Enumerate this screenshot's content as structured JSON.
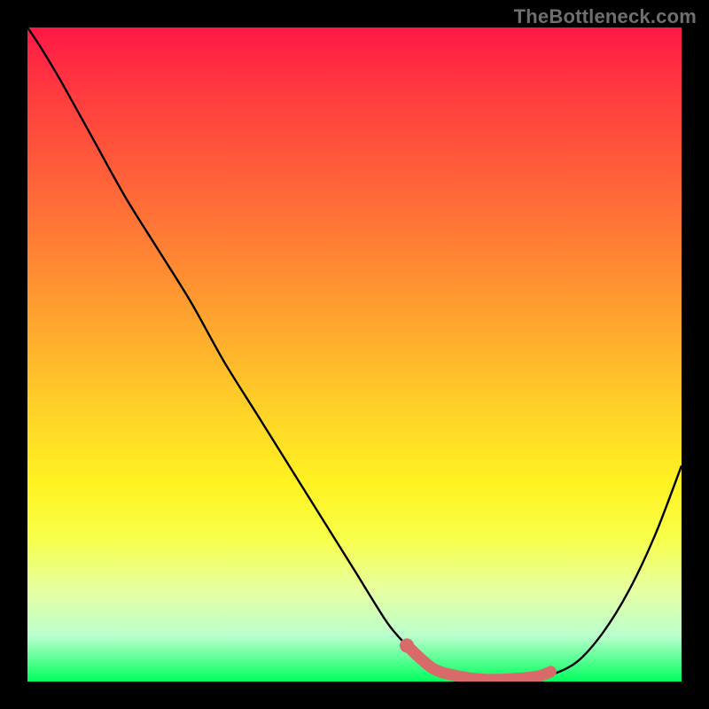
{
  "watermark_text": "TheBottleneck.com",
  "colors": {
    "background": "#000000",
    "curve": "#000000",
    "highlight": "#d86a6a",
    "gradient_top": "#ff1846",
    "gradient_bottom": "#00ff5e"
  },
  "chart_data": {
    "type": "line",
    "title": "",
    "xlabel": "",
    "ylabel": "",
    "xlim": [
      0,
      1
    ],
    "ylim": [
      0,
      1
    ],
    "grid": false,
    "legend": false,
    "series": [
      {
        "name": "curve",
        "x": [
          0.0,
          0.02,
          0.05,
          0.1,
          0.15,
          0.2,
          0.25,
          0.3,
          0.35,
          0.4,
          0.45,
          0.5,
          0.55,
          0.58,
          0.6,
          0.62,
          0.65,
          0.69,
          0.73,
          0.77,
          0.8,
          0.84,
          0.88,
          0.92,
          0.96,
          1.0
        ],
        "y": [
          1.0,
          0.97,
          0.92,
          0.83,
          0.74,
          0.66,
          0.58,
          0.49,
          0.41,
          0.33,
          0.25,
          0.17,
          0.09,
          0.055,
          0.035,
          0.02,
          0.01,
          0.003,
          0.001,
          0.003,
          0.01,
          0.03,
          0.075,
          0.14,
          0.225,
          0.33
        ]
      }
    ],
    "highlight_segment": {
      "name": "salmon-band",
      "x": [
        0.58,
        0.62,
        0.66,
        0.7,
        0.74,
        0.78,
        0.8
      ],
      "y": [
        0.055,
        0.02,
        0.008,
        0.003,
        0.004,
        0.008,
        0.015
      ]
    },
    "highlight_start_dot": {
      "x": 0.58,
      "y": 0.055
    }
  }
}
